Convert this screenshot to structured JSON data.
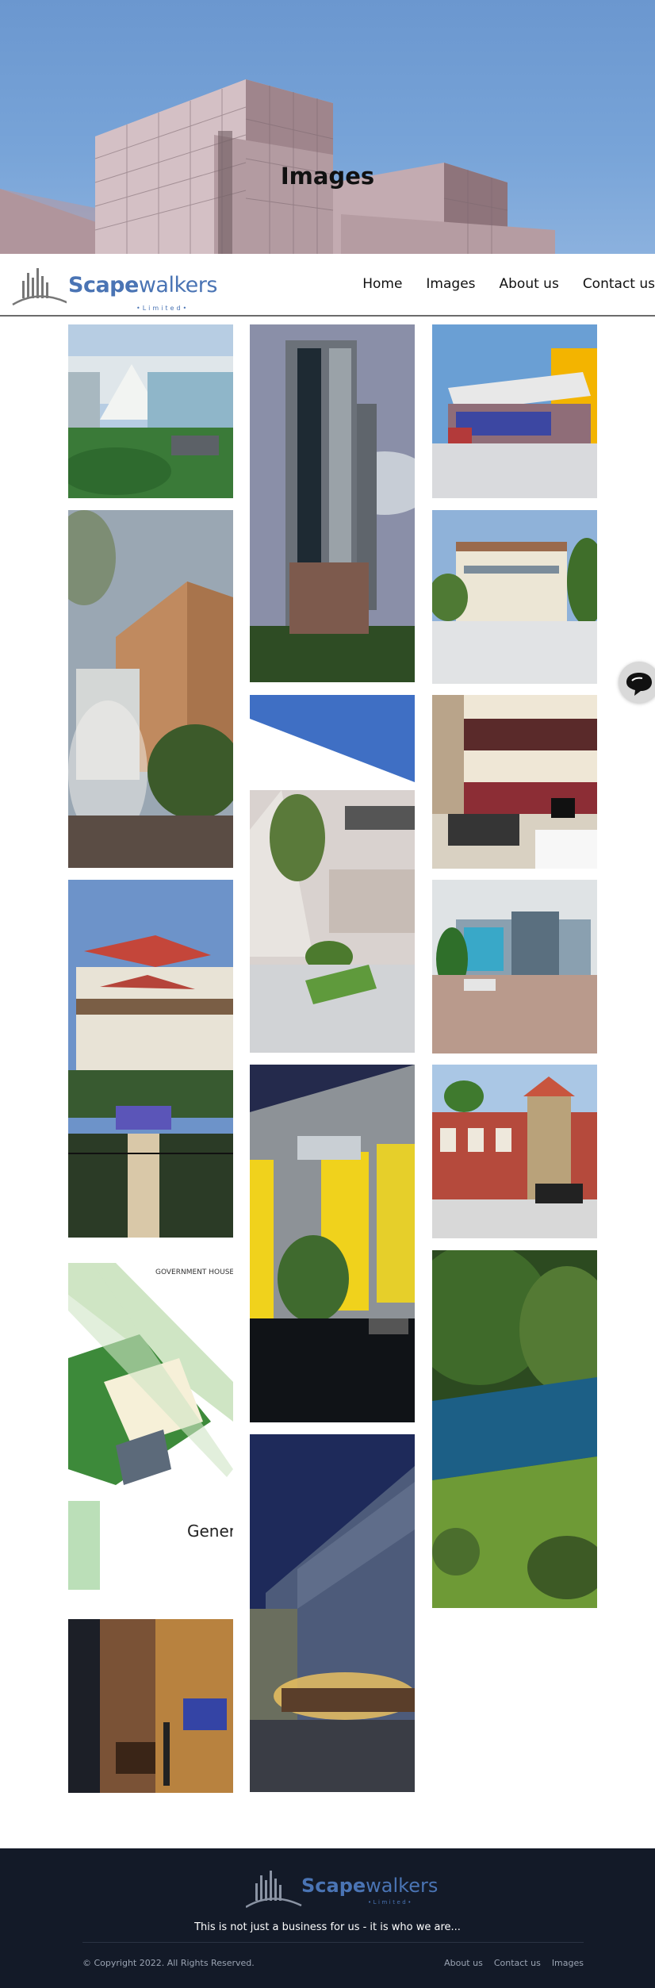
{
  "hero": {
    "title": "Images"
  },
  "brand": {
    "name_bold": "Scape",
    "name_rest": "walkers",
    "tagline": "•Limited•"
  },
  "nav": {
    "items": [
      "Home",
      "Images",
      "About us",
      "Contact us"
    ]
  },
  "gallery": {
    "items": [
      "modern-building-render",
      "tower-render",
      "canopy-building-render",
      "corner-building-render",
      "townhouses-render",
      "courtyard-building-render",
      "kitchen-interior-render",
      "villa-render",
      "office-campus-render",
      "night-facade-render",
      "colonial-house-render",
      "site-plan-drawing",
      "lake-aerial-render",
      "living-room-interior",
      "hotel-night-render"
    ],
    "site_plan_labels": {
      "top": "GOVERNMENT HOUSE",
      "side": "Genera"
    }
  },
  "footer": {
    "tagline": "This is not just a business for us - it is who we are...",
    "copyright": "© Copyright 2022. All Rights Reserved.",
    "links": [
      "About us",
      "Contact us",
      "Images"
    ]
  },
  "colors": {
    "brand": "#4a74b4",
    "footer_bg": "#131a28",
    "hero_sky": "#6b97cf"
  }
}
